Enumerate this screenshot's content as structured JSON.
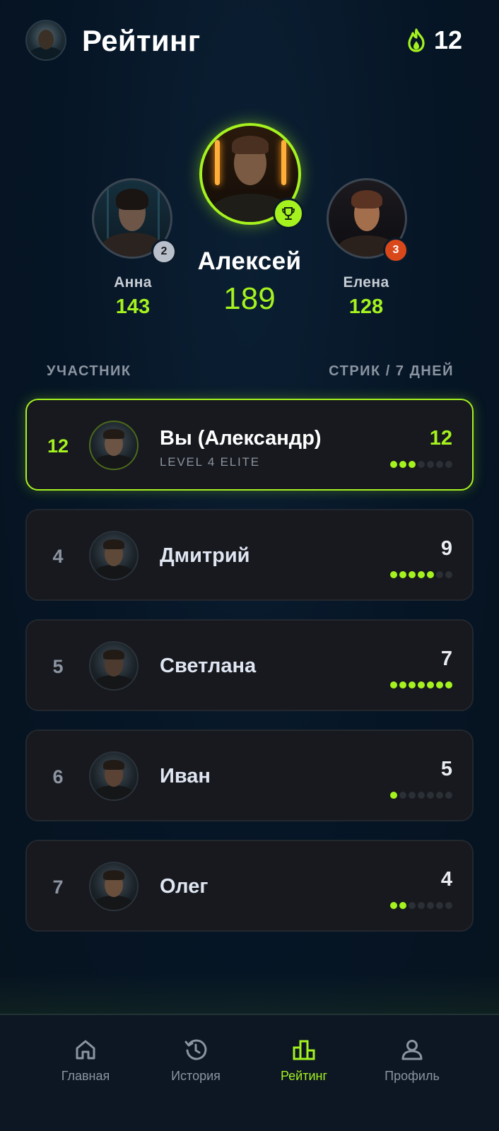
{
  "header": {
    "title": "Рейтинг",
    "streak_count": "12",
    "icons": {
      "avatar": "user-avatar",
      "streak": "flame-icon"
    }
  },
  "podium": {
    "first": {
      "name": "Алексей",
      "score": "189",
      "badge_icon": "trophy-icon"
    },
    "second": {
      "name": "Анна",
      "score": "143",
      "rank": "2"
    },
    "third": {
      "name": "Елена",
      "score": "128",
      "rank": "3"
    }
  },
  "columns": {
    "participant": "УЧАСТНИК",
    "streak": "СТРИК / 7 ДНЕЙ"
  },
  "rows": [
    {
      "rank": "12",
      "name": "Вы (Александр)",
      "subtitle": "LEVEL 4 ELITE",
      "streak": "12",
      "days_active": 3,
      "days_total": 7
    },
    {
      "rank": "4",
      "name": "Дмитрий",
      "streak": "9",
      "days_active": 5,
      "days_total": 7
    },
    {
      "rank": "5",
      "name": "Светлана",
      "streak": "7",
      "days_active": 7,
      "days_total": 7
    },
    {
      "rank": "6",
      "name": "Иван",
      "streak": "5",
      "days_active": 1,
      "days_total": 7
    },
    {
      "rank": "7",
      "name": "Олег",
      "streak": "4",
      "days_active": 2,
      "days_total": 7
    }
  ],
  "nav": [
    {
      "label": "Главная",
      "icon": "home-icon",
      "active": false
    },
    {
      "label": "История",
      "icon": "history-icon",
      "active": false
    },
    {
      "label": "Рейтинг",
      "icon": "leaderboard-icon",
      "active": true
    },
    {
      "label": "Профиль",
      "icon": "profile-icon",
      "active": false
    }
  ],
  "colors": {
    "accent": "#a5f21f",
    "background": "#061525",
    "card": "#17191e",
    "rank_silver": "#b9c0cc",
    "rank_bronze": "#d9481a"
  }
}
